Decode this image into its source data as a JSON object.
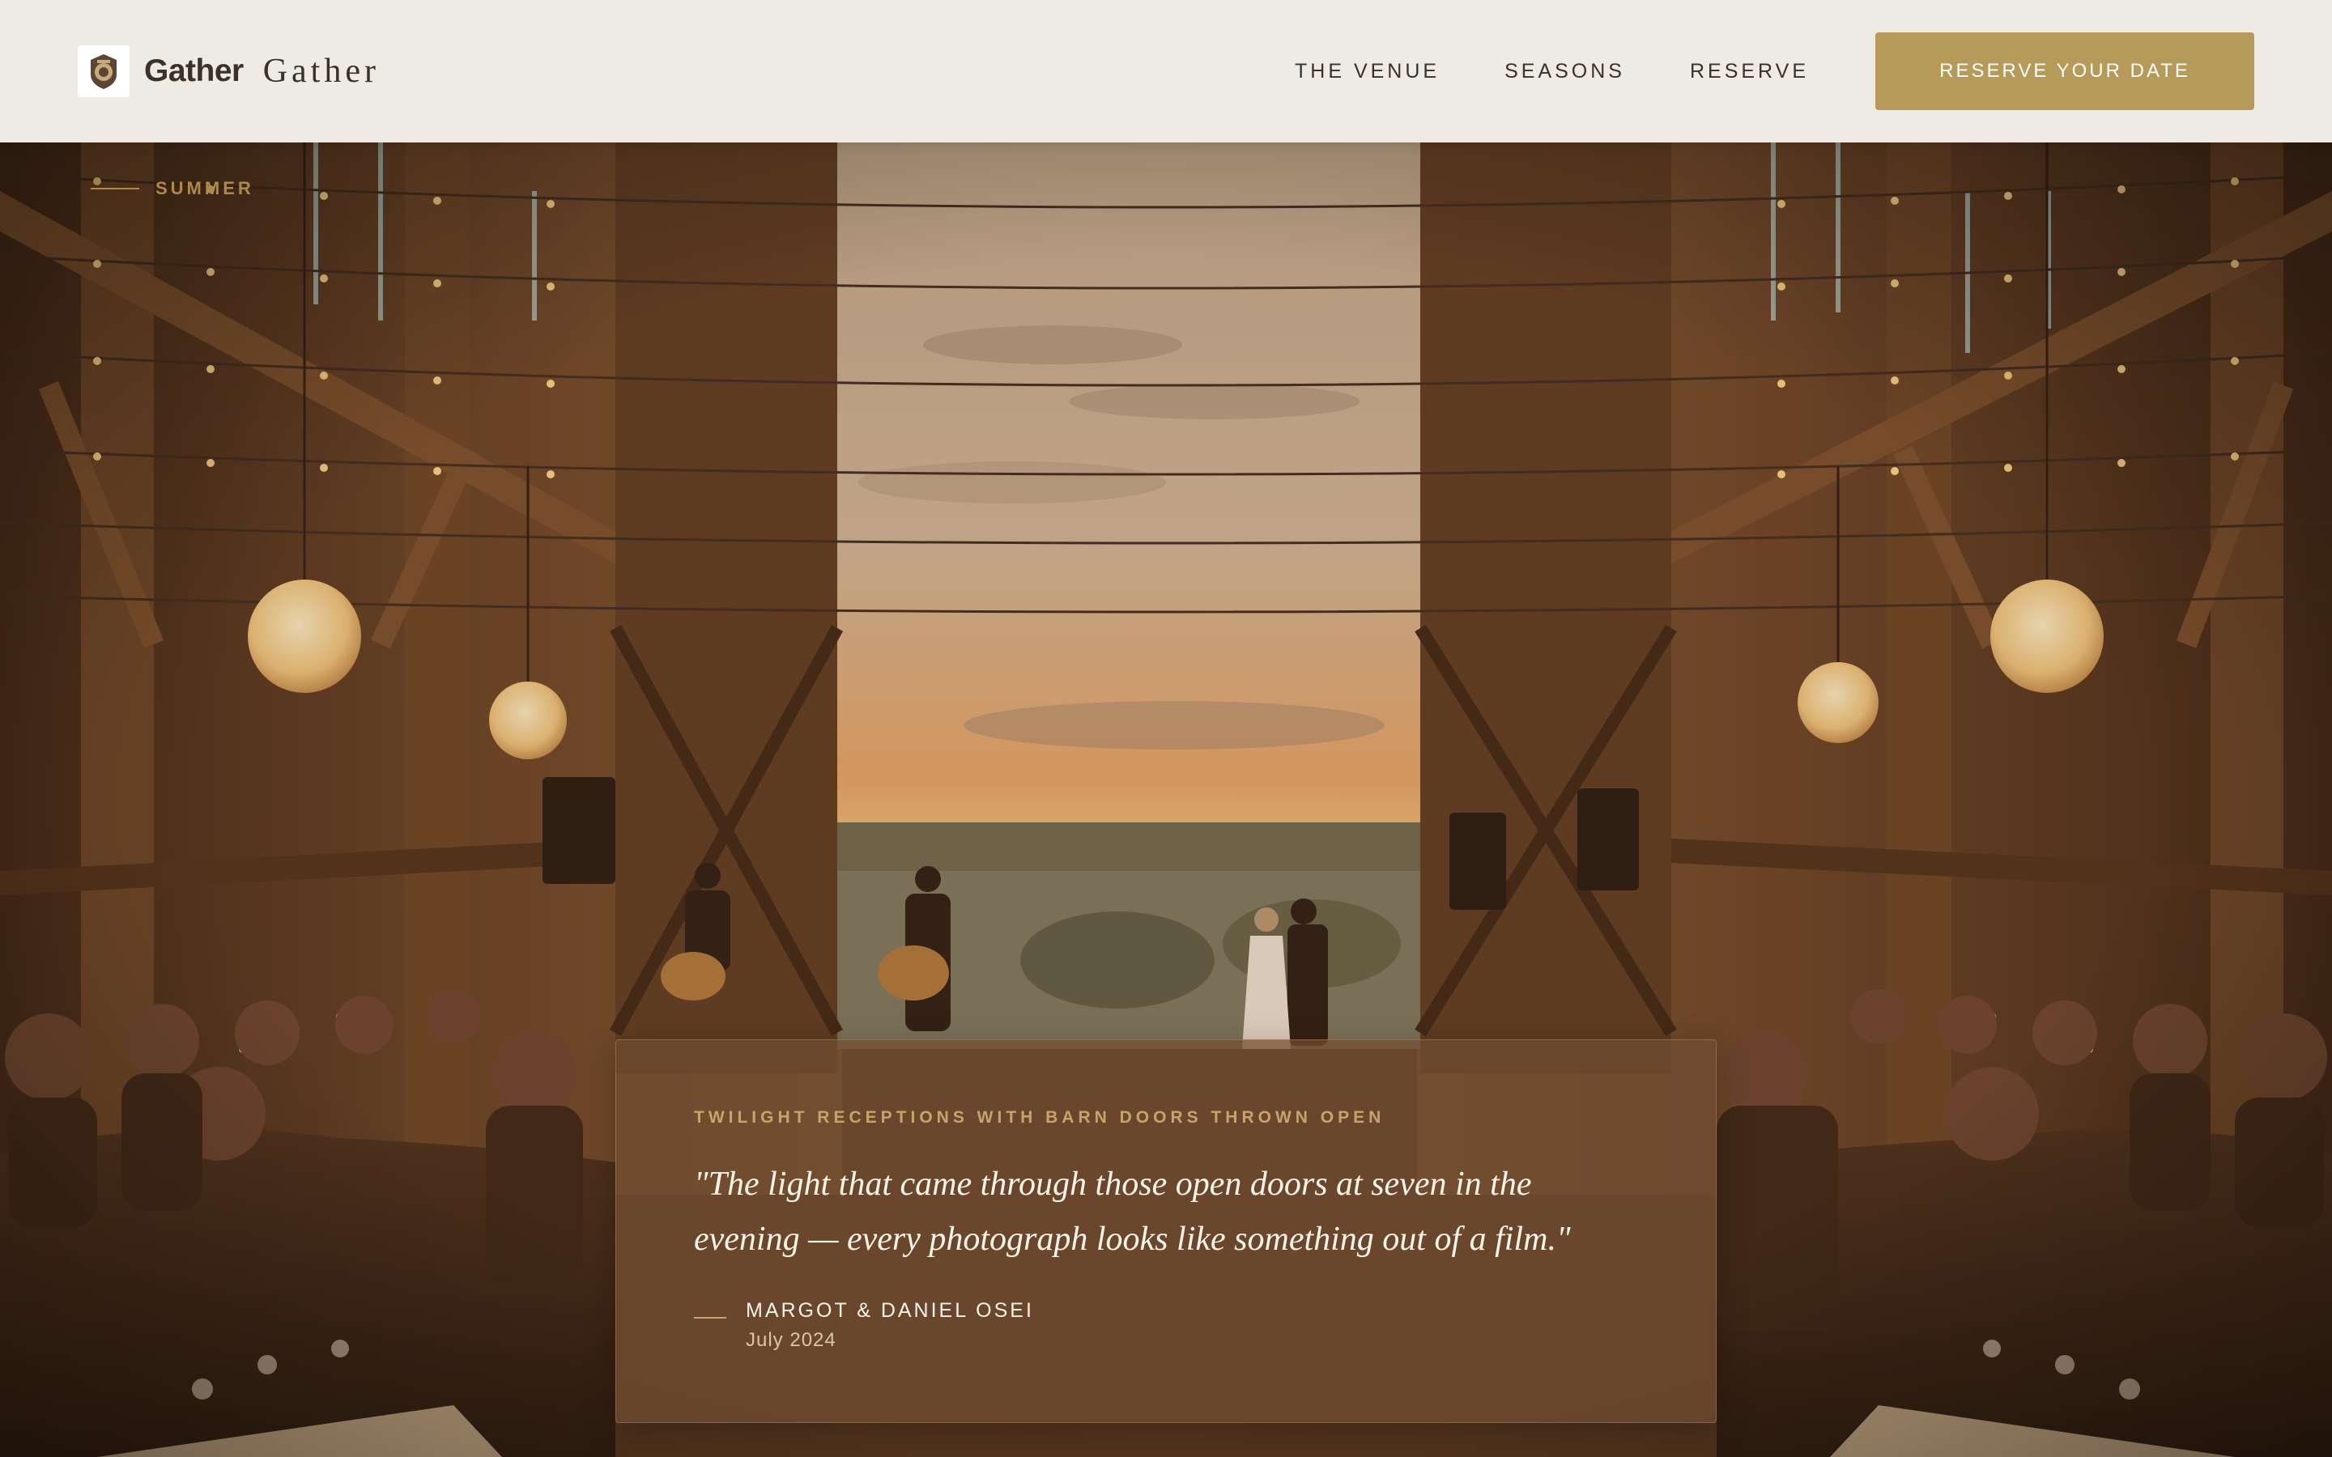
{
  "header": {
    "logo_text_bold": "Gather",
    "logo_text_serif": "Gather",
    "logo_icon": "lantern-crest-icon",
    "nav": [
      {
        "label": "THE VENUE"
      },
      {
        "label": "SEASONS"
      },
      {
        "label": "RESERVE"
      }
    ],
    "cta_label": "RESERVE YOUR DATE"
  },
  "hero": {
    "season_label": "SUMMER",
    "image": "barn-reception-photo"
  },
  "testimonial": {
    "kicker": "TWILIGHT RECEPTIONS WITH BARN DOORS THROWN OPEN",
    "quote": "\"The light that came through those open doors at seven in the evening — every photograph looks like something out of a film.\"",
    "author": "MARGOT & DANIEL OSEI",
    "date": "July 2024"
  },
  "colors": {
    "header_bg": "#eeebe4",
    "accent_gold": "#b59a5a",
    "text_dark": "#3a3128",
    "card_bg": "#704c30"
  }
}
